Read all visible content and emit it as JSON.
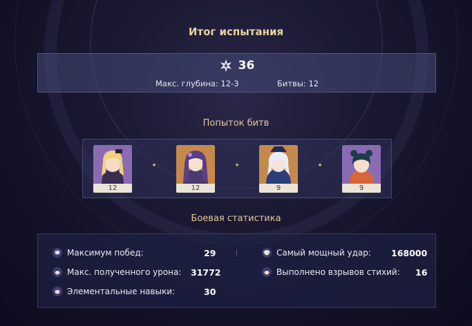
{
  "header": {
    "title": "Итог испытания"
  },
  "summary": {
    "stars": "36",
    "max_depth": "Макс. глубина: 12-3",
    "battles": "Битвы: 12",
    "star_icon": "abyss-star-icon"
  },
  "party": {
    "section_title": "Попыток битв",
    "characters": [
      {
        "name": "fischl",
        "level": "12",
        "bg": "#8a6bb3"
      },
      {
        "name": "raiden",
        "level": "12",
        "bg": "#c58a4b"
      },
      {
        "name": "furina",
        "level": "9",
        "bg": "#c58a4b"
      },
      {
        "name": "xiangling",
        "level": "9",
        "bg": "#8a6bb3"
      }
    ]
  },
  "stats": {
    "section_title": "Боевая статистика",
    "left": [
      {
        "label": "Максимум побед:",
        "value": "29",
        "icon": "character-avatar-icon"
      },
      {
        "label": "Макс. полученного урона:",
        "value": "31772",
        "icon": "character-avatar-icon"
      },
      {
        "label": "Элементальные навыки:",
        "value": "30",
        "icon": "character-avatar-icon"
      }
    ],
    "right": [
      {
        "label": "Самый мощный удар:",
        "value": "168000",
        "icon": "character-avatar-icon"
      },
      {
        "label": "Выполнено взрывов стихий:",
        "value": "16",
        "icon": "character-avatar-icon"
      }
    ]
  }
}
